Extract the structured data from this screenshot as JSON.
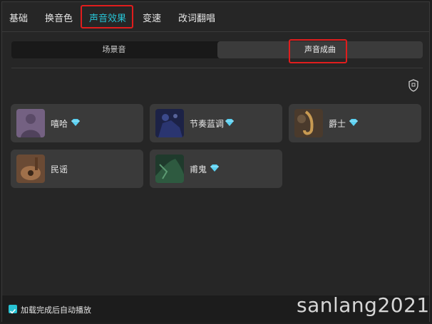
{
  "tabs": [
    {
      "label": "基础"
    },
    {
      "label": "换音色"
    },
    {
      "label": "声音效果"
    },
    {
      "label": "变速"
    },
    {
      "label": "改词翻唱"
    }
  ],
  "segment": {
    "left_label": "场景音",
    "right_label": "声音成曲"
  },
  "cards": [
    {
      "label": "嘻哈",
      "icon": "gem-icon"
    },
    {
      "label": "节奏蓝调",
      "icon": "gem-icon"
    },
    {
      "label": "爵士",
      "icon": "gem-icon"
    },
    {
      "label": "民谣",
      "icon": ""
    },
    {
      "label": "甫鬼",
      "icon": "gem-icon"
    }
  ],
  "footer": {
    "autoplay_label": "加载完成后自动播放",
    "autoplay_checked": true
  },
  "watermark": "sanlang2021",
  "colors": {
    "accent": "#27c2d3",
    "highlight": "#e11d1d",
    "card_bg": "#3a3a3a",
    "panel_bg": "#262626"
  }
}
